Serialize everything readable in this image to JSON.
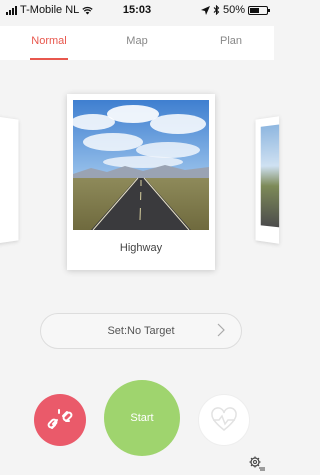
{
  "status_bar": {
    "carrier": "T-Mobile NL",
    "time": "15:03",
    "battery": "50%"
  },
  "tabs": [
    {
      "label": "Normal",
      "active": true
    },
    {
      "label": "Map",
      "active": false
    },
    {
      "label": "Plan",
      "active": false
    }
  ],
  "workout": {
    "scene_label": "Highway"
  },
  "target": {
    "label": "Set:No Target"
  },
  "actions": {
    "start_label": "Start"
  },
  "colors": {
    "accent": "#e8574d",
    "start": "#9fd46e",
    "link": "#ea5a6a"
  },
  "icons": [
    "signal-icon",
    "wifi-icon",
    "location-icon",
    "bluetooth-icon",
    "battery-icon",
    "chevron-right-icon",
    "link-broken-icon",
    "heart-rate-icon",
    "settings-icon"
  ]
}
